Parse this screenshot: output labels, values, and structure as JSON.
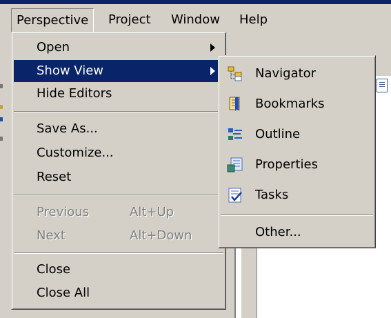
{
  "menubar": {
    "items": [
      {
        "label": "Perspective"
      },
      {
        "label": "Project"
      },
      {
        "label": "Window"
      },
      {
        "label": "Help"
      }
    ]
  },
  "perspective_menu": {
    "open": "Open",
    "show_view": "Show View",
    "hide_editors": "Hide Editors",
    "save_as": "Save As...",
    "customize": "Customize...",
    "reset": "Reset",
    "previous": "Previous",
    "previous_accel": "Alt+Up",
    "next": "Next",
    "next_accel": "Alt+Down",
    "close": "Close",
    "close_all": "Close All"
  },
  "show_view_submenu": {
    "items": [
      {
        "label": "Navigator",
        "icon": "navigator-icon"
      },
      {
        "label": "Bookmarks",
        "icon": "bookmarks-icon"
      },
      {
        "label": "Outline",
        "icon": "outline-icon"
      },
      {
        "label": "Properties",
        "icon": "properties-icon"
      },
      {
        "label": "Tasks",
        "icon": "tasks-icon"
      }
    ],
    "other": "Other..."
  },
  "colors": {
    "menu_bg": "#d4d0c8",
    "highlight": "#0a246a",
    "disabled": "#808080"
  }
}
